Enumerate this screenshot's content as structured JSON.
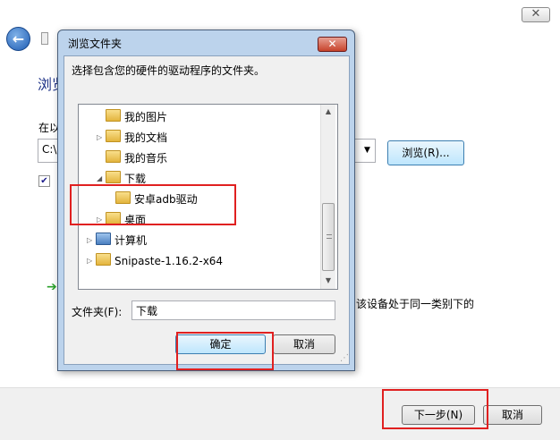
{
  "wizard": {
    "heading": "浏览",
    "search_label": "在以",
    "path_value": "C:\\",
    "device_text": "该设备处于同一类别下的",
    "next_label": "下一步(N)",
    "cancel_label": "取消",
    "browse_label": "浏览(R)..."
  },
  "dialog": {
    "title": "浏览文件夹",
    "close_glyph": "✕",
    "instruction": "选择包含您的硬件的驱动程序的文件夹。",
    "tree": [
      {
        "label": "我的图片",
        "level": 2,
        "expander": "none"
      },
      {
        "label": "我的文档",
        "level": 2,
        "expander": "collapsed"
      },
      {
        "label": "我的音乐",
        "level": 2,
        "expander": "none"
      },
      {
        "label": "下载",
        "level": 2,
        "expander": "expanded",
        "selected": true
      },
      {
        "label": "安卓adb驱动",
        "level": 3,
        "expander": "none"
      },
      {
        "label": "桌面",
        "level": 2,
        "expander": "collapsed"
      },
      {
        "label": "计算机",
        "level": 1,
        "expander": "collapsed"
      },
      {
        "label": "Snipaste-1.16.2-x64",
        "level": 1,
        "expander": "collapsed"
      }
    ],
    "folder_label": "文件夹(F):",
    "folder_value": "下载",
    "ok_label": "确定",
    "cancel_label": "取消"
  },
  "colors": {
    "highlight": "#e02020",
    "title_bar": "#bcd3ec",
    "heading_blue": "#1e3287"
  }
}
